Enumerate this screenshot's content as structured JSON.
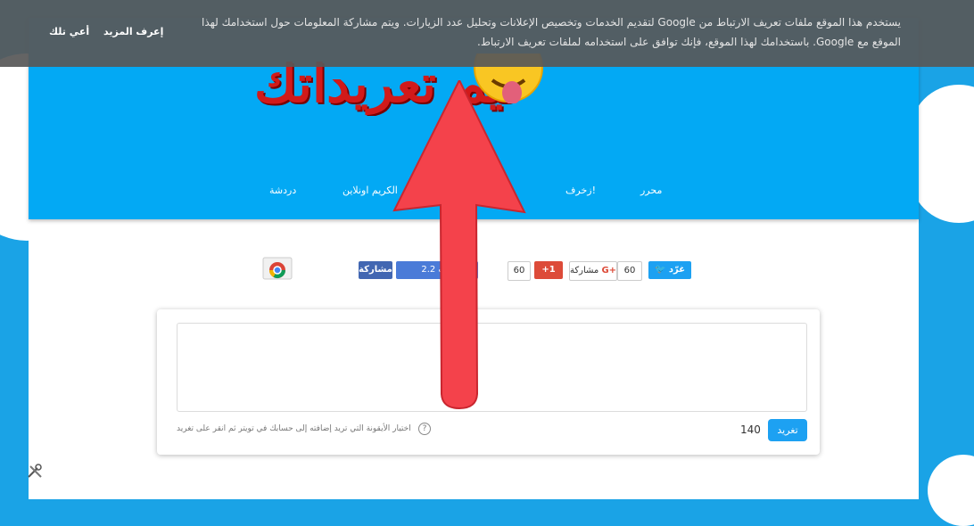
{
  "cookie": {
    "text": "يستخدم هذا الموقع ملفات تعريف الارتباط من Google لتقديم الخدمات وتخصيص الإعلانات وتحليل عدد الزيارات. ويتم مشاركة المعلومات حول استخدامك لهذا الموقع مع Google. باستخدامك لهذا الموقع، فإنك توافق على استخدامه لملفات تعريف الارتباط.",
    "learn_more": "إعرف المزيد",
    "got_it": "أعي تلك"
  },
  "header": {
    "logo_text": "ليم تعريداتك"
  },
  "nav": {
    "editor": "محرر",
    "decorate": "زخرف!",
    "kareem": "الكريم اونلاين",
    "chat": "دردشة"
  },
  "share": {
    "tweet": "غرّد",
    "tweet_count": "60",
    "gplus_share": "مشاركة",
    "gplus_count": "60",
    "gplus_one": "+1",
    "fb_like": "2.2 ألف",
    "fb_share": "مشاركة"
  },
  "editor": {
    "tweet_button": "تغريد",
    "char_count": "140",
    "hint": "اختيار الأيقونة التي تريد إضافته إلى حسابك في تويتر ثم انقر على تغريد"
  },
  "colors": {
    "header_blue": "#03a9f4",
    "twitter_blue": "#1da1f2",
    "arrow_red": "#f4424b"
  }
}
